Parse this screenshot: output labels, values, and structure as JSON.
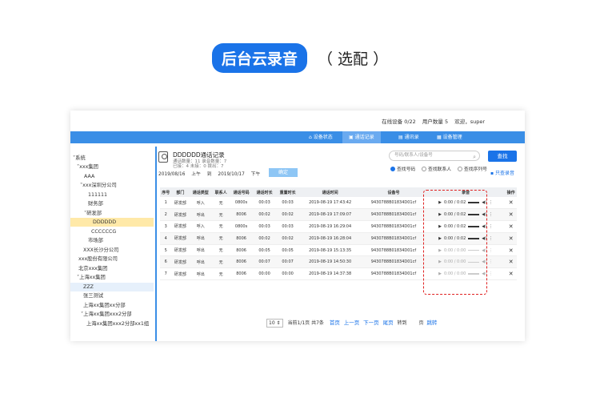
{
  "heading": {
    "pill": "后台云录音",
    "suffix": "（ 选配 ）"
  },
  "topinfo": {
    "online": "在线设备 0/22",
    "users": "用户数量 5",
    "welcome": "欢迎，super"
  },
  "nav": [
    "设备状态",
    "通话记录",
    "通讯录",
    "设备管理"
  ],
  "tree": [
    "系统",
    "xxx集团",
    "AAA",
    "xxx深圳分公司",
    "111111",
    "财务部",
    "研发部",
    "DDDDDD",
    "CCCCCCG",
    "市场部",
    "XXX长沙分公司",
    "xxx股份有限公司",
    "北京xxx集团",
    "上海xx集团",
    "ZZZ",
    "张三测试",
    "上海xx集团xx分部",
    "上海xx集团xxx2分部",
    "上海xx集团xxx2分部xx1组"
  ],
  "detail": {
    "title": "DDDDDD通话记录",
    "sub1": "通话数量：11  录音数量：7",
    "sub2": "已接：4    未接：0   拨出：7",
    "date_from": "2019/08/16",
    "ampm_from": "上午",
    "to_label": "到",
    "date_to": "2019/10/17",
    "ampm_to": "下午",
    "confirm": "确定"
  },
  "search": {
    "placeholder": "号码/联系人/设备号",
    "button": "查找",
    "radio1": "查找号码",
    "radio2": "查找联系人",
    "radio3": "查找序列号",
    "only_recorded": "只查录音"
  },
  "table": {
    "headers": [
      "序号",
      "部门",
      "通话类型",
      "联系人",
      "通话号码",
      "通话时长",
      "重置时长",
      "通话时间",
      "设备号",
      "录音",
      "操作"
    ],
    "rows": [
      [
        "1",
        "研发部",
        "呼入",
        "无",
        "0800s",
        "00:03",
        "00:03",
        "2019-08-19 17:43:42",
        "9430788B01834D01cf",
        "0:00 / 0:02"
      ],
      [
        "2",
        "研发部",
        "呼出",
        "无",
        "8006",
        "00:02",
        "00:02",
        "2019-08-19 17:09:07",
        "9430788B01834D01cf",
        "0:00 / 0:02"
      ],
      [
        "3",
        "研发部",
        "呼入",
        "无",
        "0800s",
        "00:03",
        "00:03",
        "2019-08-19 16:29:04",
        "9430788B01834D01cf",
        "0:00 / 0:02"
      ],
      [
        "4",
        "研发部",
        "呼出",
        "无",
        "8006",
        "00:02",
        "00:02",
        "2019-08-19 16:28:04",
        "9430788B01834D01cf",
        "0:00 / 0:02"
      ],
      [
        "5",
        "研发部",
        "呼出",
        "无",
        "8006",
        "00:05",
        "00:05",
        "2019-08-19 15:13:35",
        "9430788B01834D01cf",
        "0:00 / 0:00"
      ],
      [
        "6",
        "研发部",
        "呼出",
        "无",
        "8006",
        "00:07",
        "00:07",
        "2019-08-19 14:50:30",
        "9430788B01834D01cf",
        "0:00 / 0:00"
      ],
      [
        "7",
        "研发部",
        "呼出",
        "无",
        "8006",
        "00:00",
        "00:00",
        "2019-08-19 14:37:38",
        "9430788B01834D01cf",
        "0:00 / 0:00"
      ]
    ]
  },
  "pager": {
    "size": "10",
    "info": "当前1/1页 共7条",
    "first": "首页",
    "prev": "上一页",
    "next": "下一页",
    "last": "尾页",
    "goto": "转到",
    "page_unit": "页",
    "jump": "跳转"
  }
}
